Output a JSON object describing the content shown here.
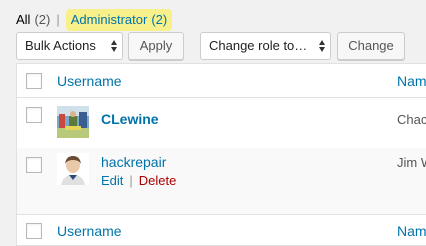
{
  "filters": {
    "all_label": "All",
    "all_count": "(2)",
    "separator": "|",
    "admin_label": "Administrator",
    "admin_count": "(2)"
  },
  "tablenav": {
    "bulk_actions": "Bulk Actions",
    "apply": "Apply",
    "change_role": "Change role to…",
    "change": "Change"
  },
  "table": {
    "col_username": "Username",
    "col_name": "Nam",
    "users": [
      {
        "username": "CLewine",
        "name": "Chac"
      },
      {
        "username": "hackrepair",
        "name": "Jim W",
        "actions": {
          "edit": "Edit",
          "sep": "|",
          "delete": "Delete"
        }
      }
    ],
    "footer_username": "Username",
    "footer_name": "Nam"
  }
}
